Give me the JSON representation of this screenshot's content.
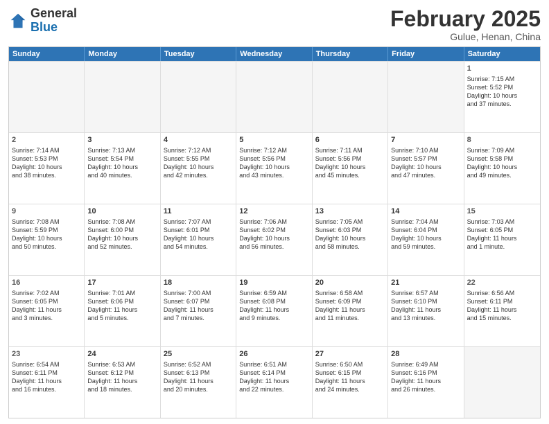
{
  "header": {
    "logo_general": "General",
    "logo_blue": "Blue",
    "month_title": "February 2025",
    "subtitle": "Gulue, Henan, China"
  },
  "days_of_week": [
    "Sunday",
    "Monday",
    "Tuesday",
    "Wednesday",
    "Thursday",
    "Friday",
    "Saturday"
  ],
  "weeks": [
    [
      {
        "day": "",
        "info": "",
        "empty": true
      },
      {
        "day": "",
        "info": "",
        "empty": true
      },
      {
        "day": "",
        "info": "",
        "empty": true
      },
      {
        "day": "",
        "info": "",
        "empty": true
      },
      {
        "day": "",
        "info": "",
        "empty": true
      },
      {
        "day": "",
        "info": "",
        "empty": true
      },
      {
        "day": "1",
        "info": "Sunrise: 7:15 AM\nSunset: 5:52 PM\nDaylight: 10 hours\nand 37 minutes.",
        "empty": false
      }
    ],
    [
      {
        "day": "2",
        "info": "Sunrise: 7:14 AM\nSunset: 5:53 PM\nDaylight: 10 hours\nand 38 minutes.",
        "empty": false
      },
      {
        "day": "3",
        "info": "Sunrise: 7:13 AM\nSunset: 5:54 PM\nDaylight: 10 hours\nand 40 minutes.",
        "empty": false
      },
      {
        "day": "4",
        "info": "Sunrise: 7:12 AM\nSunset: 5:55 PM\nDaylight: 10 hours\nand 42 minutes.",
        "empty": false
      },
      {
        "day": "5",
        "info": "Sunrise: 7:12 AM\nSunset: 5:56 PM\nDaylight: 10 hours\nand 43 minutes.",
        "empty": false
      },
      {
        "day": "6",
        "info": "Sunrise: 7:11 AM\nSunset: 5:56 PM\nDaylight: 10 hours\nand 45 minutes.",
        "empty": false
      },
      {
        "day": "7",
        "info": "Sunrise: 7:10 AM\nSunset: 5:57 PM\nDaylight: 10 hours\nand 47 minutes.",
        "empty": false
      },
      {
        "day": "8",
        "info": "Sunrise: 7:09 AM\nSunset: 5:58 PM\nDaylight: 10 hours\nand 49 minutes.",
        "empty": false
      }
    ],
    [
      {
        "day": "9",
        "info": "Sunrise: 7:08 AM\nSunset: 5:59 PM\nDaylight: 10 hours\nand 50 minutes.",
        "empty": false
      },
      {
        "day": "10",
        "info": "Sunrise: 7:08 AM\nSunset: 6:00 PM\nDaylight: 10 hours\nand 52 minutes.",
        "empty": false
      },
      {
        "day": "11",
        "info": "Sunrise: 7:07 AM\nSunset: 6:01 PM\nDaylight: 10 hours\nand 54 minutes.",
        "empty": false
      },
      {
        "day": "12",
        "info": "Sunrise: 7:06 AM\nSunset: 6:02 PM\nDaylight: 10 hours\nand 56 minutes.",
        "empty": false
      },
      {
        "day": "13",
        "info": "Sunrise: 7:05 AM\nSunset: 6:03 PM\nDaylight: 10 hours\nand 58 minutes.",
        "empty": false
      },
      {
        "day": "14",
        "info": "Sunrise: 7:04 AM\nSunset: 6:04 PM\nDaylight: 10 hours\nand 59 minutes.",
        "empty": false
      },
      {
        "day": "15",
        "info": "Sunrise: 7:03 AM\nSunset: 6:05 PM\nDaylight: 11 hours\nand 1 minute.",
        "empty": false
      }
    ],
    [
      {
        "day": "16",
        "info": "Sunrise: 7:02 AM\nSunset: 6:05 PM\nDaylight: 11 hours\nand 3 minutes.",
        "empty": false
      },
      {
        "day": "17",
        "info": "Sunrise: 7:01 AM\nSunset: 6:06 PM\nDaylight: 11 hours\nand 5 minutes.",
        "empty": false
      },
      {
        "day": "18",
        "info": "Sunrise: 7:00 AM\nSunset: 6:07 PM\nDaylight: 11 hours\nand 7 minutes.",
        "empty": false
      },
      {
        "day": "19",
        "info": "Sunrise: 6:59 AM\nSunset: 6:08 PM\nDaylight: 11 hours\nand 9 minutes.",
        "empty": false
      },
      {
        "day": "20",
        "info": "Sunrise: 6:58 AM\nSunset: 6:09 PM\nDaylight: 11 hours\nand 11 minutes.",
        "empty": false
      },
      {
        "day": "21",
        "info": "Sunrise: 6:57 AM\nSunset: 6:10 PM\nDaylight: 11 hours\nand 13 minutes.",
        "empty": false
      },
      {
        "day": "22",
        "info": "Sunrise: 6:56 AM\nSunset: 6:11 PM\nDaylight: 11 hours\nand 15 minutes.",
        "empty": false
      }
    ],
    [
      {
        "day": "23",
        "info": "Sunrise: 6:54 AM\nSunset: 6:11 PM\nDaylight: 11 hours\nand 16 minutes.",
        "empty": false
      },
      {
        "day": "24",
        "info": "Sunrise: 6:53 AM\nSunset: 6:12 PM\nDaylight: 11 hours\nand 18 minutes.",
        "empty": false
      },
      {
        "day": "25",
        "info": "Sunrise: 6:52 AM\nSunset: 6:13 PM\nDaylight: 11 hours\nand 20 minutes.",
        "empty": false
      },
      {
        "day": "26",
        "info": "Sunrise: 6:51 AM\nSunset: 6:14 PM\nDaylight: 11 hours\nand 22 minutes.",
        "empty": false
      },
      {
        "day": "27",
        "info": "Sunrise: 6:50 AM\nSunset: 6:15 PM\nDaylight: 11 hours\nand 24 minutes.",
        "empty": false
      },
      {
        "day": "28",
        "info": "Sunrise: 6:49 AM\nSunset: 6:16 PM\nDaylight: 11 hours\nand 26 minutes.",
        "empty": false
      },
      {
        "day": "",
        "info": "",
        "empty": true
      }
    ]
  ]
}
